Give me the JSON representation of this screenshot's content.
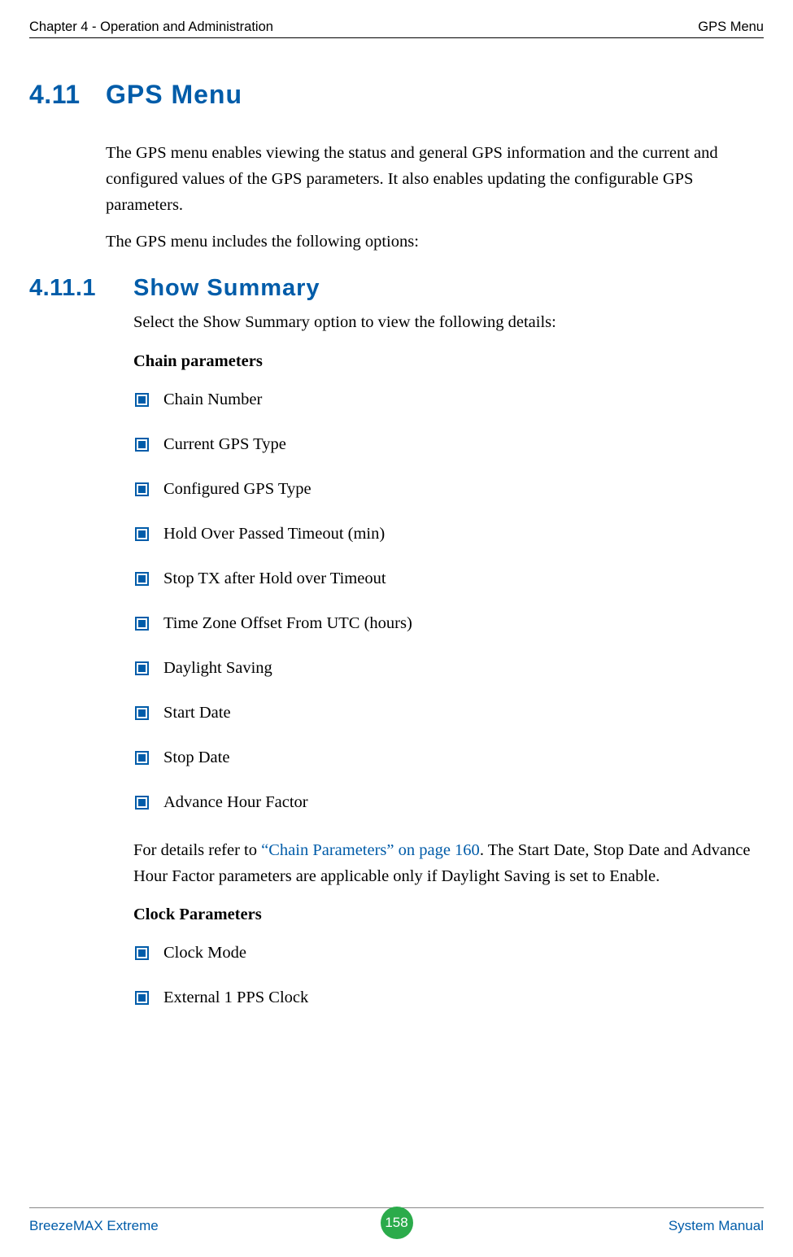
{
  "header": {
    "left": "Chapter 4 - Operation and Administration",
    "right": "GPS Menu"
  },
  "h1": {
    "num": "4.11",
    "text": "GPS Menu"
  },
  "intro": {
    "p1": "The GPS menu enables viewing the status and general GPS information and the current and configured values of the GPS parameters. It also enables updating the configurable GPS parameters.",
    "p2": "The GPS menu includes the following options:"
  },
  "h2": {
    "num": "4.11.1",
    "text": "Show Summary"
  },
  "summary_lead": "Select the Show Summary option to view the following details:",
  "chain_heading": "Chain parameters",
  "chain_items": {
    "0": "Chain Number",
    "1": "Current GPS Type",
    "2": "Configured GPS Type",
    "3": "Hold Over Passed Timeout (min)",
    "4": "Stop TX after Hold over Timeout",
    "5": "Time Zone Offset From UTC (hours)",
    "6": "Daylight Saving",
    "7": "Start Date",
    "8": "Stop Date",
    "9": "Advance Hour Factor"
  },
  "chain_note": {
    "pre": "For details refer to ",
    "xref": "“Chain Parameters” on page 160",
    "post": ". The Start Date, Stop Date and Advance Hour Factor parameters are applicable only if Daylight Saving is set to Enable."
  },
  "clock_heading": "Clock Parameters",
  "clock_items": {
    "0": "Clock Mode",
    "1": "External 1 PPS Clock"
  },
  "footer": {
    "left": "BreezeMAX Extreme",
    "page": "158",
    "right": "System Manual"
  }
}
